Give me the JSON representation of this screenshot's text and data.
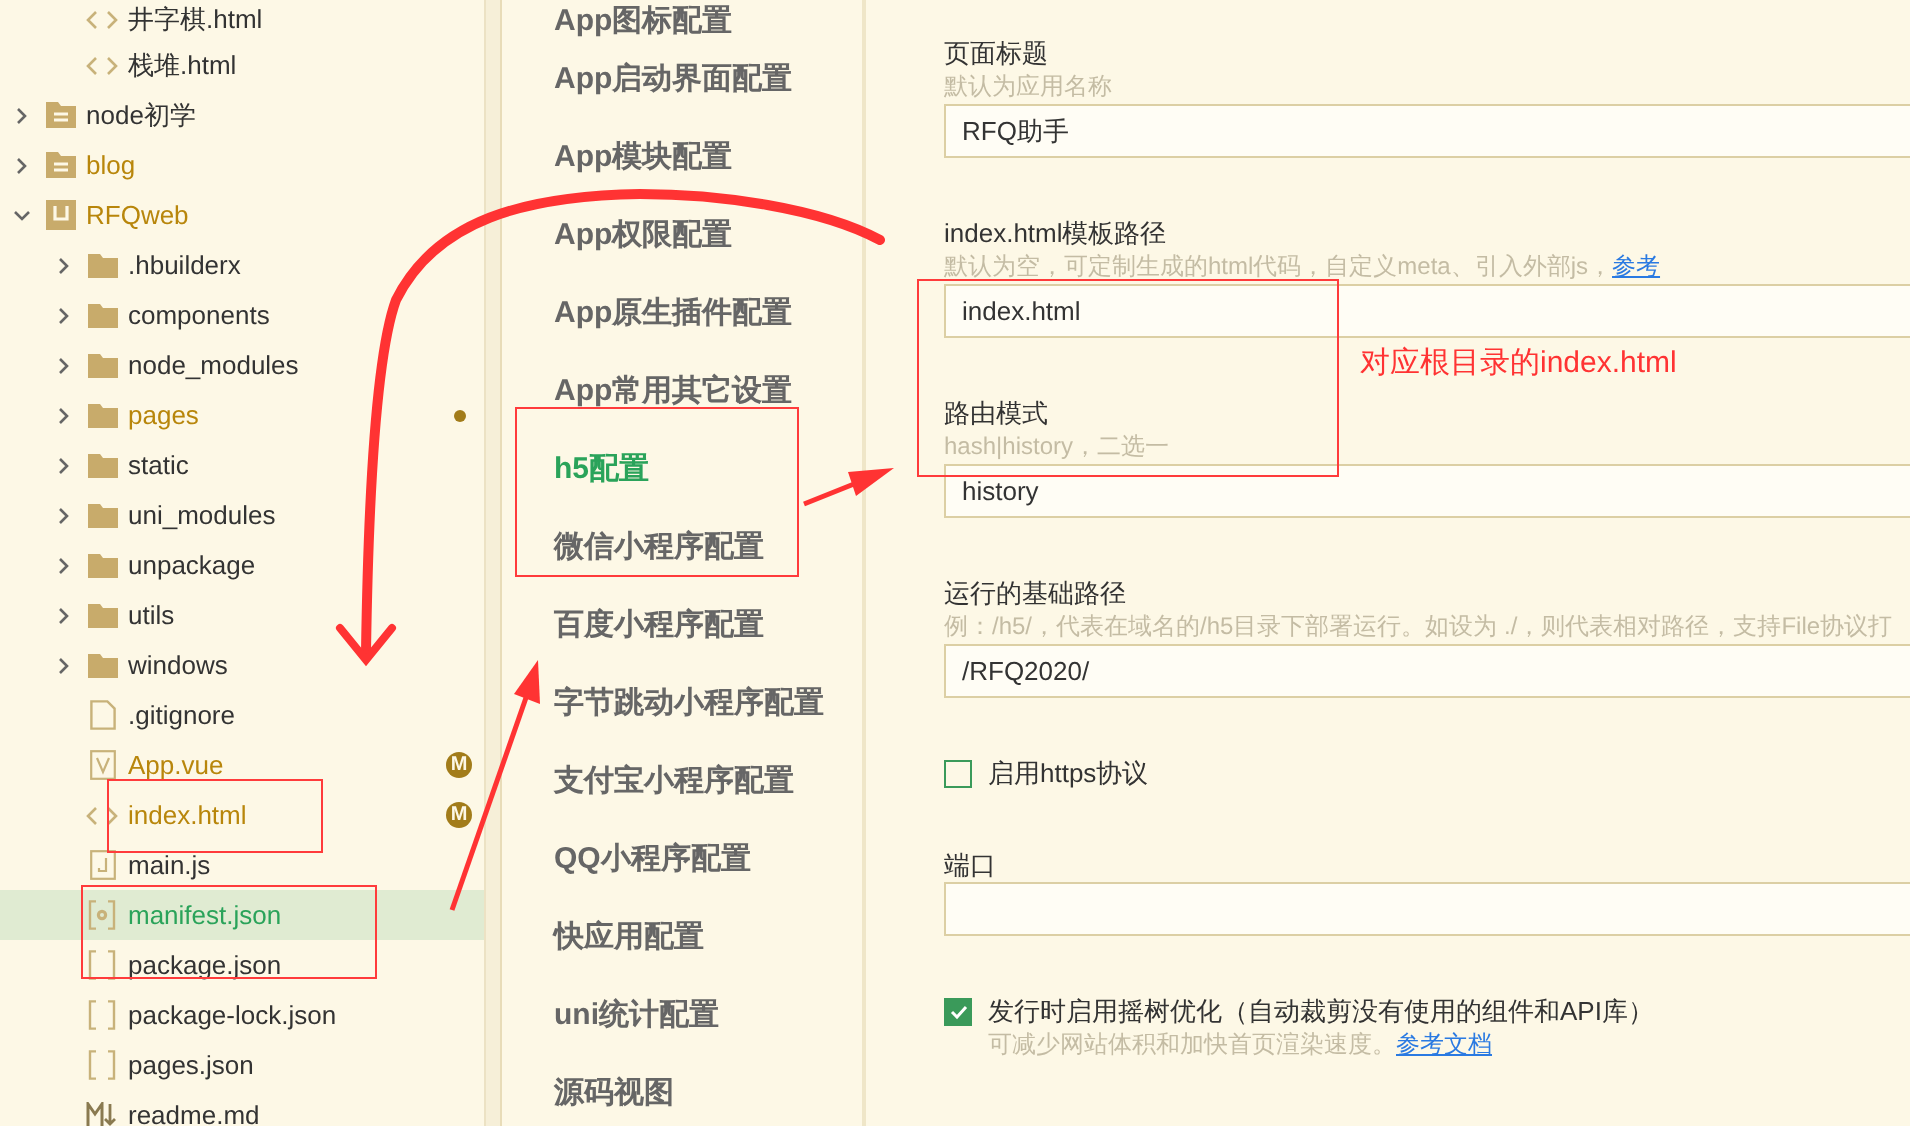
{
  "tree_top_children": [
    {
      "kind": "html",
      "label": "井字棋.html",
      "modified": false,
      "selected": false,
      "dot": false
    },
    {
      "kind": "html",
      "label": "栈堆.html",
      "modified": false,
      "selected": false,
      "dot": false
    }
  ],
  "tree": [
    {
      "kind": "docfolder",
      "label": "node初学",
      "expanded": false,
      "modified": false,
      "selected": false,
      "dot": false
    },
    {
      "kind": "docfolder",
      "label": "blog",
      "expanded": false,
      "modified": true,
      "selected": false,
      "dot": false
    },
    {
      "kind": "project",
      "label": "RFQweb",
      "expanded": true,
      "modified": true,
      "selected": false,
      "dot": false,
      "children": [
        {
          "kind": "folder",
          "label": ".hbuilderx",
          "expanded": false,
          "modified": false,
          "selected": false,
          "dot": false
        },
        {
          "kind": "folder",
          "label": "components",
          "expanded": false,
          "modified": false,
          "selected": false,
          "dot": false
        },
        {
          "kind": "folder",
          "label": "node_modules",
          "expanded": false,
          "modified": false,
          "selected": false,
          "dot": false
        },
        {
          "kind": "folder",
          "label": "pages",
          "expanded": false,
          "modified": true,
          "selected": false,
          "dot": true
        },
        {
          "kind": "folder",
          "label": "static",
          "expanded": false,
          "modified": false,
          "selected": false,
          "dot": false
        },
        {
          "kind": "folder",
          "label": "uni_modules",
          "expanded": false,
          "modified": false,
          "selected": false,
          "dot": false
        },
        {
          "kind": "folder",
          "label": "unpackage",
          "expanded": false,
          "modified": false,
          "selected": false,
          "dot": false
        },
        {
          "kind": "folder",
          "label": "utils",
          "expanded": false,
          "modified": false,
          "selected": false,
          "dot": false
        },
        {
          "kind": "folder",
          "label": "windows",
          "expanded": false,
          "modified": false,
          "selected": false,
          "dot": false
        },
        {
          "kind": "blank",
          "label": ".gitignore",
          "modified": false,
          "selected": false,
          "dot": false
        },
        {
          "kind": "vue",
          "label": "App.vue",
          "modified": true,
          "selected": false,
          "dot": false,
          "badge": "M"
        },
        {
          "kind": "html",
          "label": "index.html",
          "modified": true,
          "selected": false,
          "dot": false,
          "badge": "M"
        },
        {
          "kind": "js",
          "label": "main.js",
          "modified": false,
          "selected": false,
          "dot": false
        },
        {
          "kind": "manifest",
          "label": "manifest.json",
          "modified": false,
          "selected": true,
          "dot": false
        },
        {
          "kind": "json",
          "label": "package.json",
          "modified": false,
          "selected": false,
          "dot": false
        },
        {
          "kind": "json",
          "label": "package-lock.json",
          "modified": false,
          "selected": false,
          "dot": false
        },
        {
          "kind": "json",
          "label": "pages.json",
          "modified": false,
          "selected": false,
          "dot": false
        },
        {
          "kind": "md",
          "label": "readme.md",
          "modified": false,
          "selected": false,
          "dot": false
        }
      ]
    }
  ],
  "nav": [
    {
      "label": "App图标配置",
      "selected": false
    },
    {
      "label": "App启动界面配置",
      "selected": false
    },
    {
      "label": "App模块配置",
      "selected": false
    },
    {
      "label": "App权限配置",
      "selected": false
    },
    {
      "label": "App原生插件配置",
      "selected": false
    },
    {
      "label": "App常用其它设置",
      "selected": false
    },
    {
      "label": "h5配置",
      "selected": true
    },
    {
      "label": "微信小程序配置",
      "selected": false
    },
    {
      "label": "百度小程序配置",
      "selected": false
    },
    {
      "label": "字节跳动小程序配置",
      "selected": false
    },
    {
      "label": "支付宝小程序配置",
      "selected": false
    },
    {
      "label": "QQ小程序配置",
      "selected": false
    },
    {
      "label": "快应用配置",
      "selected": false
    },
    {
      "label": "uni统计配置",
      "selected": false
    },
    {
      "label": "源码视图",
      "selected": false
    }
  ],
  "form": [
    {
      "kind": "text",
      "label": "页面标题",
      "hint": "默认为应用名称",
      "value": "RFQ助手"
    },
    {
      "kind": "text",
      "label": "index.html模板路径",
      "hint": "默认为空，可定制生成的html代码，自定义meta、引入外部js，",
      "hint_link": "参考",
      "value": "index.html"
    },
    {
      "kind": "text",
      "label": "路由模式",
      "hint": "hash|history，二选一",
      "value": "history"
    },
    {
      "kind": "text",
      "label": "运行的基础路径",
      "hint": "例：/h5/，代表在域名的/h5目录下部署运行。如设为 ./，则代表相对路径，支持File协议打",
      "value": "/RFQ2020/"
    },
    {
      "kind": "checkbox",
      "label": "启用https协议",
      "checked": false
    },
    {
      "kind": "text",
      "label": "端口"
    },
    {
      "kind": "checkbox",
      "label": "发行时启用摇树优化（自动裁剪没有使用的组件和API库）",
      "checked": true,
      "hint": "可减少网站体积和加快首页渲染速度。",
      "hint_link": "参考文档"
    }
  ],
  "annotation": {
    "note": "对应根目录的index.html"
  }
}
